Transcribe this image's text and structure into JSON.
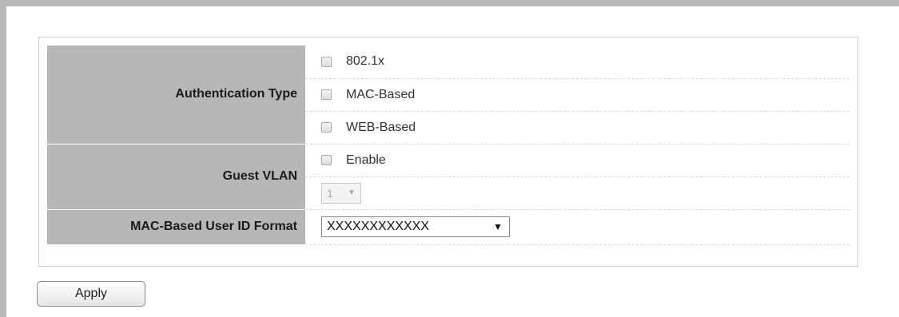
{
  "settings": {
    "auth_type": {
      "label": "Authentication Type",
      "options": [
        {
          "label": "802.1x",
          "checked": false
        },
        {
          "label": "MAC-Based",
          "checked": false
        },
        {
          "label": "WEB-Based",
          "checked": false
        }
      ]
    },
    "guest_vlan": {
      "label": "Guest VLAN",
      "enable_label": "Enable",
      "enable_checked": false,
      "vlan_value": "1",
      "vlan_disabled": true
    },
    "mac_user_id": {
      "label": "MAC-Based User ID Format",
      "value": "XXXXXXXXXXXX"
    }
  },
  "actions": {
    "apply_label": "Apply"
  },
  "icons": {
    "dropdown": "chevron-down-icon",
    "checkbox": "checkbox-icon"
  }
}
